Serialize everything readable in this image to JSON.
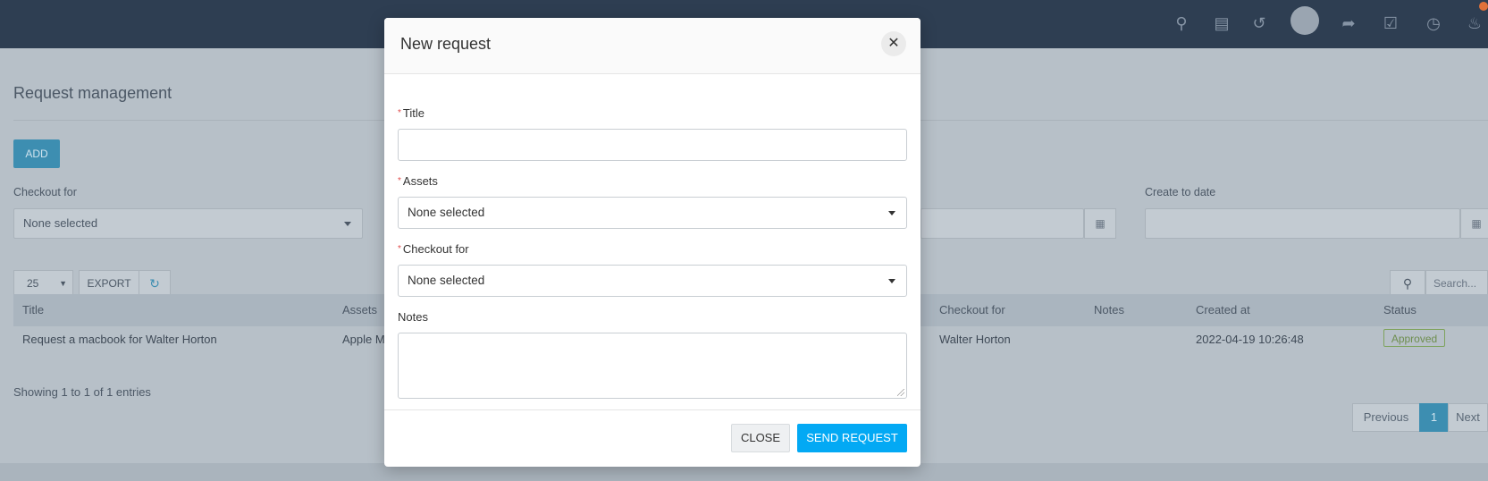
{
  "background": {
    "page_title": "Request management",
    "add_label": "ADD",
    "filters": {
      "checkout_for_label": "Checkout for",
      "checkout_for_value": "None selected",
      "create_to_date_label": "Create to date"
    },
    "toolbar": {
      "page_size": "25",
      "export_label": "EXPORT",
      "search_placeholder": "Search..."
    },
    "table": {
      "columns": [
        "Title",
        "Assets",
        "Checkout for",
        "Notes",
        "Created at",
        "Status"
      ],
      "rows": [
        {
          "title": "Request a macbook for Walter Horton",
          "assets": "Apple M",
          "checkout_for": "Walter Horton",
          "notes": "",
          "created_at": "2022-04-19 10:26:48",
          "status": "Approved"
        }
      ]
    },
    "showing": "Showing 1 to 1 of 1 entries",
    "pagination": {
      "previous": "Previous",
      "current": "1",
      "next": "Next"
    }
  },
  "modal": {
    "title": "New request",
    "required_mark": "*",
    "fields": {
      "title_label": "Title",
      "title_value": "",
      "assets_label": "Assets",
      "assets_value": "None selected",
      "checkout_for_label": "Checkout for",
      "checkout_for_value": "None selected",
      "notes_label": "Notes",
      "notes_value": ""
    },
    "close_label": "CLOSE",
    "send_label": "SEND REQUEST"
  },
  "colors": {
    "primary": "#03a9f4",
    "topbar": "#2e3e52",
    "required": "#e04b4b",
    "status_approved": "#6e8e4f"
  },
  "icons": {
    "close": "close-icon",
    "caret": "chevron-down-icon",
    "calendar": "calendar-icon"
  }
}
